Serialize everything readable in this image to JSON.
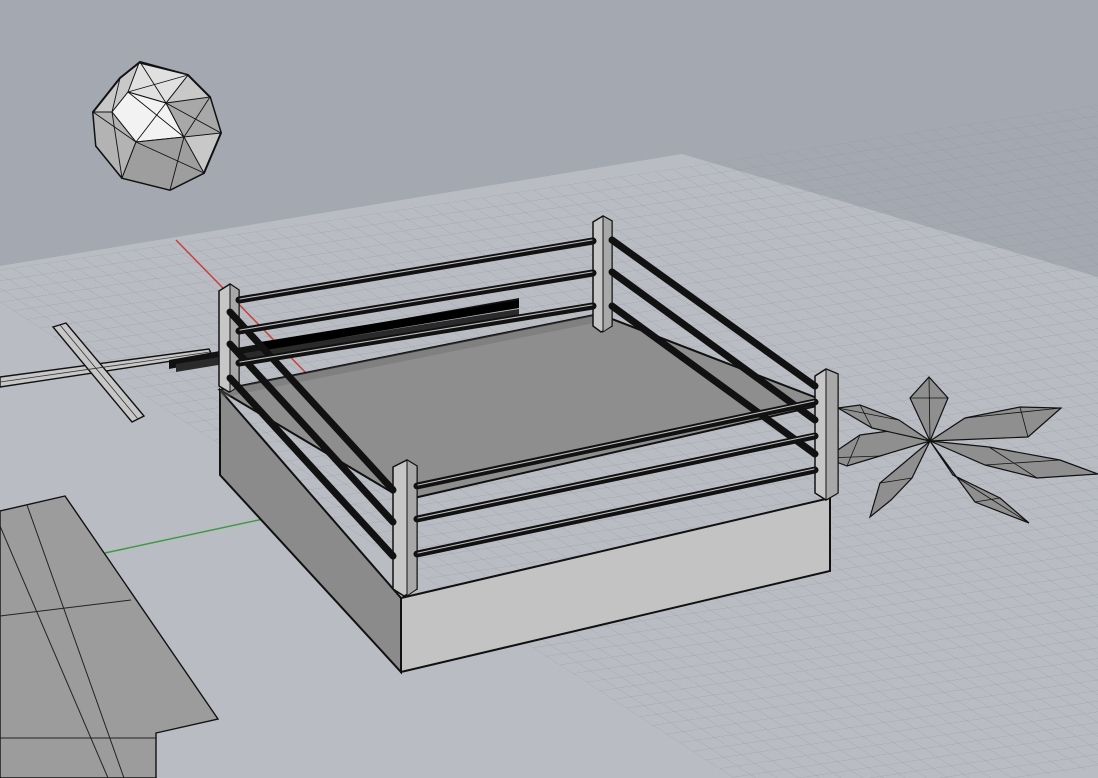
{
  "viewport": {
    "kind": "perspective-3d-viewport",
    "background_color": "#a4a9b1",
    "grid_color": "#b9bdc3",
    "grid_line_color": "#8d939b",
    "x_axis_color": "#c8403a",
    "y_axis_color": "#3f9a45",
    "edge_color": "#111111"
  },
  "objects": [
    {
      "name": "polyhedron",
      "shape": "faceted sphere"
    },
    {
      "name": "boxing-ring",
      "shape": "ring with corner posts and ropes"
    },
    {
      "name": "cross-shape",
      "shape": "thin flat cross"
    },
    {
      "name": "black-bars",
      "shape": "long dark bars"
    },
    {
      "name": "flat-slab",
      "shape": "large flat plate"
    },
    {
      "name": "flower-mesh",
      "shape": "triangulated star flower"
    }
  ]
}
